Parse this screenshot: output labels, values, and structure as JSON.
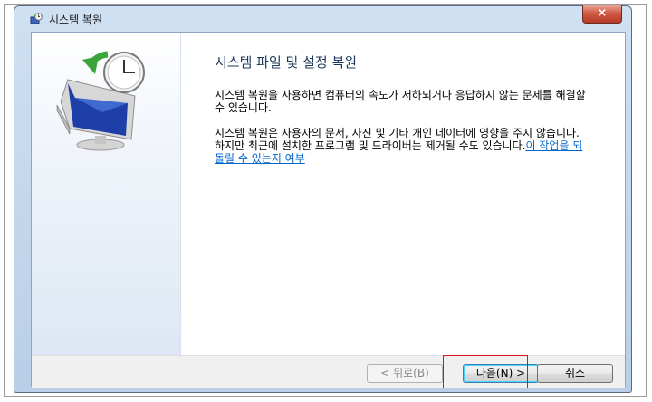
{
  "window": {
    "title": "시스템 복원",
    "close_label": "×"
  },
  "icons": {
    "app": "system-restore-icon",
    "hero": "restore-monitor-clock-icon",
    "close": "close-icon"
  },
  "content": {
    "heading": "시스템 파일 및 설정 복원",
    "paragraph1": "시스템 복원을 사용하면 컴퓨터의 속도가 저하되거나 응답하지 않는 문제를 해결할 수 있습니다.",
    "paragraph2": "시스템 복원은 사용자의 문서, 사진 및 기타 개인 데이터에 영향을 주지 않습니다. 하지만 최근에 설치한 프로그램 및 드라이버는 제거될 수도 있습니다.",
    "link": "이 작업을 되돌릴 수 있는지 여부"
  },
  "buttons": {
    "back": "< 뒤로(B)",
    "next": "다음(N) >",
    "cancel": "취소"
  },
  "colors": {
    "heading": "#1e395b",
    "link": "#0066cc",
    "highlight": "#d8111c"
  }
}
